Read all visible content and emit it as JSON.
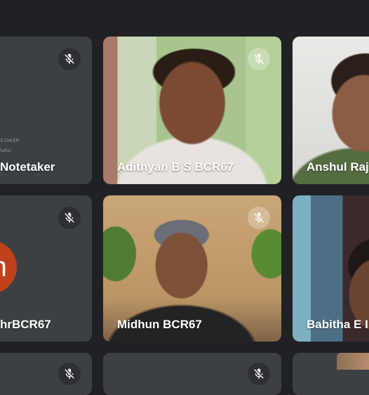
{
  "tiles": [
    {
      "name": "Notetaker",
      "muted": true
    },
    {
      "name": "Adithyan B S BCR67",
      "muted": true
    },
    {
      "name": "Anshul Raj",
      "muted": false
    },
    {
      "name": "hrBCR67",
      "muted": true,
      "avatar_letter": "m",
      "avatar_color": "#c0401a"
    },
    {
      "name": "Midhun BCR67",
      "muted": true
    },
    {
      "name": "Babitha E I",
      "muted": false
    }
  ],
  "notetaker_card": {
    "line1": "H NOTETAKER",
    "line2": "ne of Rahul"
  },
  "colors": {
    "background": "#202124",
    "tile": "#3c4043"
  }
}
